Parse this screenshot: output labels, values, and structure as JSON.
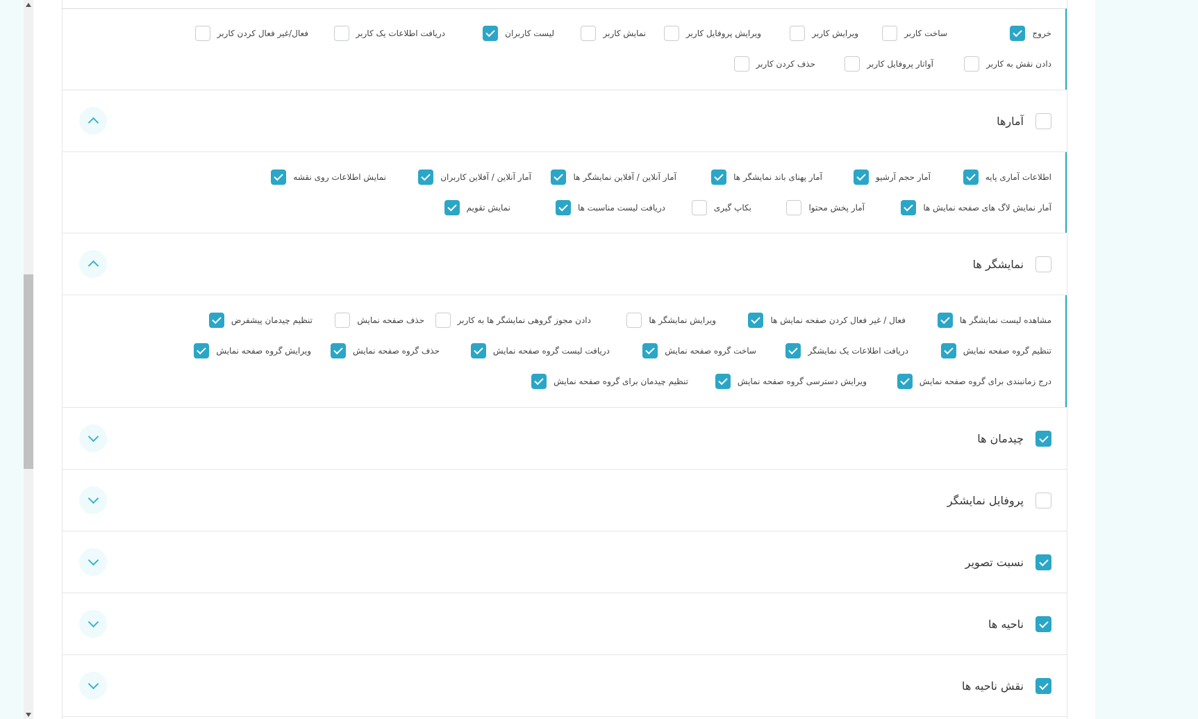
{
  "users_permissions": {
    "row1": [
      {
        "label": "خروج",
        "checked": true
      },
      {
        "label": "ساخت کاربر",
        "checked": false
      },
      {
        "label": "ویرایش کاربر",
        "checked": false
      },
      {
        "label": "ویرایش پروفایل کاربر",
        "checked": false
      },
      {
        "label": "نمایش کاربر",
        "checked": false
      },
      {
        "label": "لیست کاربران",
        "checked": true
      },
      {
        "label": "دریافت اطلاعات یک کاربر",
        "checked": false
      },
      {
        "label": "فعال/غیر فعال کردن کاربر",
        "checked": false
      }
    ],
    "row2": [
      {
        "label": "دادن نقش به کاربر",
        "checked": false
      },
      {
        "label": "آواتار پروفایل کاربر",
        "checked": false
      },
      {
        "label": "حذف کردن کاربر",
        "checked": false
      }
    ]
  },
  "sections": {
    "stats": {
      "title": "آمارها",
      "checked": false,
      "expanded": true
    },
    "displays": {
      "title": "نمایشگر ها",
      "checked": false,
      "expanded": true
    },
    "layouts": {
      "title": "چیدمان ها",
      "checked": true,
      "expanded": false
    },
    "display_profile": {
      "title": "پروفایل نمایشگر",
      "checked": false,
      "expanded": false
    },
    "aspect_ratio": {
      "title": "نسبت تصویر",
      "checked": true,
      "expanded": false
    },
    "regions": {
      "title": "ناحیه ها",
      "checked": true,
      "expanded": false
    },
    "region_roles": {
      "title": "نقش ناحیه ها",
      "checked": true,
      "expanded": false
    }
  },
  "stats_permissions": {
    "row1": [
      {
        "label": "اطلاعات آماری پایه",
        "checked": true
      },
      {
        "label": "آمار حجم آرشیو",
        "checked": true
      },
      {
        "label": "آمار پهنای باند نمایشگر ها",
        "checked": true
      },
      {
        "label": "آمار آنلاین / آفلاین نمایشگر ها",
        "checked": true
      },
      {
        "label": "آمار آنلاین / آفلاین کاربران",
        "checked": true
      },
      {
        "label": "نمایش اطلاعات روی نقشه",
        "checked": true
      }
    ],
    "row2": [
      {
        "label": "آمار نمایش لاگ های صفحه نمایش ها",
        "checked": true
      },
      {
        "label": "آمار پخش محتوا",
        "checked": false
      },
      {
        "label": "بکاپ گیری",
        "checked": false
      },
      {
        "label": "دریافت لیست مناسبت ها",
        "checked": true
      },
      {
        "label": "نمایش تقویم",
        "checked": true
      }
    ]
  },
  "display_permissions": {
    "row1": [
      {
        "label": "مشاهده لیست نمایشگر ها",
        "checked": true
      },
      {
        "label": "فعال / غیر فعال کردن صفحه نمایش ها",
        "checked": true
      },
      {
        "label": "ویرایش نمایشگر ها",
        "checked": false
      },
      {
        "label": "دادن مجوز گروهی نمایشگر ها به کاربر",
        "checked": false
      },
      {
        "label": "حذف صفحه نمایش",
        "checked": false
      },
      {
        "label": "تنظیم چیدمان پیشفرض",
        "checked": true
      }
    ],
    "row2": [
      {
        "label": "تنظیم گروه صفحه نمایش",
        "checked": true
      },
      {
        "label": "دریافت اطلاعات یک نمایشگر",
        "checked": true
      },
      {
        "label": "ساخت گروه صفحه نمایش",
        "checked": true
      },
      {
        "label": "دریافت لیست گروه صفحه نمایش",
        "checked": true
      },
      {
        "label": "حذف گروه صفحه نمایش",
        "checked": true
      },
      {
        "label": "ویرایش گروه صفحه نمایش",
        "checked": true
      }
    ],
    "row3": [
      {
        "label": "درج زمانبندی برای گروه صفحه نمایش",
        "checked": true
      },
      {
        "label": "ویرایش دسترسی گروه صفحه نمایش",
        "checked": true
      },
      {
        "label": "تنظیم چیدمان برای گروه صفحه نمایش",
        "checked": true
      }
    ]
  },
  "colors": {
    "accent": "#2ba6c6",
    "toggle_bg": "#eefafc",
    "side_bg": "#f2fbfb"
  }
}
